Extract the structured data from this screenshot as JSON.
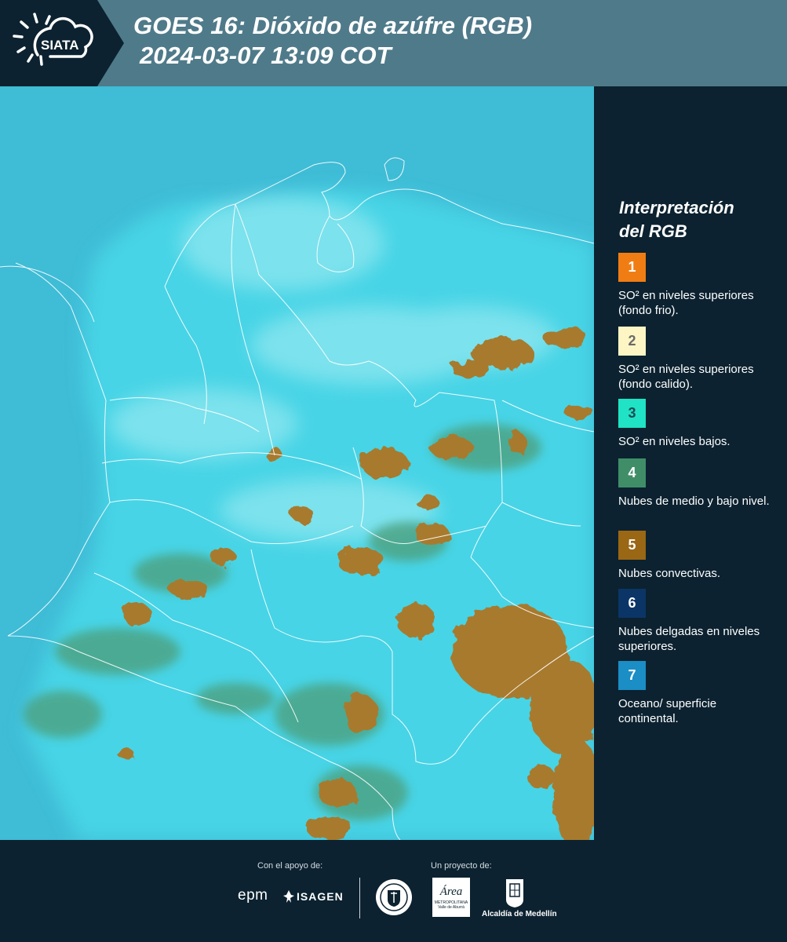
{
  "header": {
    "logo_text": "SIATA",
    "title_line1": "GOES 16: Dióxido de azúfre (RGB)",
    "title_line2": "2024-03-07 13:09 COT"
  },
  "legend": {
    "title_line1": "Interpretación",
    "title_line2": "del RGB",
    "items": [
      {
        "number": "1",
        "label": "SO² en niveles superiores (fondo frio).",
        "color": "#f07d14",
        "text_color": "#ffffff"
      },
      {
        "number": "2",
        "label": "SO² en niveles superiores (fondo calido).",
        "color": "#fdf6c4",
        "text_color": "#6a6a6a"
      },
      {
        "number": "3",
        "label": "SO² en niveles bajos.",
        "color": "#1fe3c4",
        "text_color": "#1b4a55"
      },
      {
        "number": "4",
        "label": "Nubes de medio y bajo nivel.",
        "color": "#3f8e68",
        "text_color": "#ffffff"
      },
      {
        "number": "5",
        "label": "Nubes convectivas.",
        "color": "#9a6714",
        "text_color": "#ffffff"
      },
      {
        "number": "6",
        "label": "Nubes delgadas en niveles superiores.",
        "color": "#0b3566",
        "text_color": "#ffffff"
      },
      {
        "number": "7",
        "label": "Oceano/ superficie continental.",
        "color": "#1a8ec5",
        "text_color": "#ffffff"
      }
    ]
  },
  "footer": {
    "support_label": "Con el apoyo de:",
    "project_label": "Un proyecto de:",
    "sponsor1": "epm",
    "sponsor2": "ISAGEN",
    "area_name": "Área",
    "area_sub1": "METROPOLITANA",
    "area_sub2": "Valle de Aburrá",
    "city": "Alcaldía de Medellín"
  },
  "map_colors": {
    "ocean": "#3fbcd6",
    "continental": "#45d6e8",
    "haze": "#a9eef3",
    "convective": "#a87a2e",
    "mid_low": "#4d9d78",
    "border": "#ffffff"
  }
}
